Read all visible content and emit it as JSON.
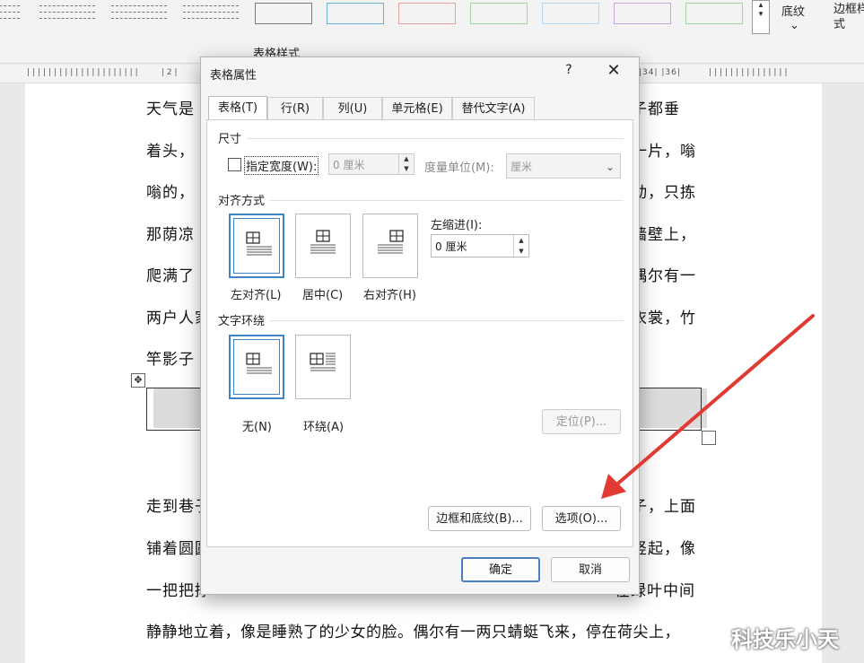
{
  "ribbon": {
    "group_label": "表格样式",
    "shading_label": "底纹",
    "border_styles_label": "边框样式",
    "chevron": "⌄"
  },
  "ruler": {
    "left_marks": "| 2 |",
    "right_marks": "|34| |36|"
  },
  "document": {
    "lines_top": [
      {
        "left": "天气是",
        "right": "子都垂"
      },
      {
        "left": "着头，",
        "right": "一片，嗡"
      },
      {
        "left": "嗡的，",
        "right": "动，只拣"
      },
      {
        "left": "那荫凉",
        "right": "墙壁上，"
      },
      {
        "left": "爬满了",
        "right": "偶尔有一"
      },
      {
        "left": "两户人家",
        "right": "衣裳，竹"
      },
      {
        "left": "竿影子",
        "right": ""
      }
    ],
    "lines_bottom": [
      {
        "left": "走到巷子",
        "right": "子，上面"
      },
      {
        "left": "铺着圆圆",
        "right": "竖起，像"
      },
      {
        "left": "一把把撑",
        "right": "在绿叶中间"
      },
      {
        "full": "静静地立着，像是睡熟了的少女的脸。偶尔有一两只蜻蜓飞来，停在荷尖上，"
      }
    ],
    "move_handle_icon": "✥"
  },
  "watermark": "科技乐小天",
  "dialog": {
    "title": "表格属性",
    "help": "?",
    "close": "✕",
    "tabs": [
      {
        "label": "表格(T)",
        "active": true
      },
      {
        "label": "行(R)",
        "active": false
      },
      {
        "label": "列(U)",
        "active": false
      },
      {
        "label": "单元格(E)",
        "active": false
      },
      {
        "label": "替代文字(A)",
        "active": false
      }
    ],
    "size": {
      "section": "尺寸",
      "preferred_width_label": "指定宽度(W):",
      "preferred_width_checked": false,
      "preferred_width_value": "0 厘米",
      "measure_label": "度量单位(M):",
      "measure_value": "厘米"
    },
    "alignment": {
      "section": "对齐方式",
      "options": [
        {
          "label": "左对齐(L)",
          "selected": true
        },
        {
          "label": "居中(C)",
          "selected": false
        },
        {
          "label": "右对齐(H)",
          "selected": false
        }
      ],
      "indent_label": "左缩进(I):",
      "indent_value": "0 厘米"
    },
    "wrapping": {
      "section": "文字环绕",
      "options": [
        {
          "label": "无(N)",
          "selected": true
        },
        {
          "label": "环绕(A)",
          "selected": false
        }
      ],
      "position_button": "定位(P)..."
    },
    "borders_button": "边框和底纹(B)...",
    "options_button": "选项(O)...",
    "ok_button": "确定",
    "cancel_button": "取消"
  },
  "colors": {
    "accent_blue": "#3d83c7",
    "annotation_arrow": "#e03a32"
  }
}
